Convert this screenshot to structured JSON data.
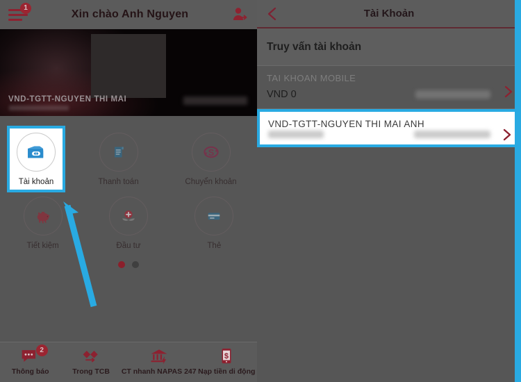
{
  "colors": {
    "accent_blue": "#29aae2",
    "brand_red": "#8e2230",
    "overlay_gray": "#565656",
    "white": "#ffffff"
  },
  "left_panel": {
    "header": {
      "menu_icon": "hamburger-menu-icon",
      "menu_badge": "1",
      "title": "Xin chào Anh Nguyen",
      "logout_icon": "logout-person-icon"
    },
    "hero": {
      "account_label": "VND-TGTT-NGUYEN THI MAI"
    },
    "grid": {
      "rows": [
        [
          {
            "label": "Tài khoản",
            "icon": "wallet-icon",
            "selected": true
          },
          {
            "label": "Thanh toán",
            "icon": "bill-icon",
            "selected": false
          },
          {
            "label": "Chuyển khoản",
            "icon": "transfer-money-icon",
            "selected": false
          }
        ],
        [
          {
            "label": "Tiết kiệm",
            "icon": "piggy-bank-icon",
            "selected": false
          },
          {
            "label": "Đầu tư",
            "icon": "investment-icon",
            "selected": false
          },
          {
            "label": "Thẻ",
            "icon": "credit-card-icon",
            "selected": false
          }
        ]
      ],
      "page_dots": [
        {
          "state": "active"
        },
        {
          "state": "idle"
        }
      ]
    },
    "bottom_nav": [
      {
        "label": "Thông báo",
        "icon": "chat-bubble-icon",
        "badge": "2"
      },
      {
        "label": "Trong TCB",
        "icon": "transfer-arrow-icon",
        "badge": ""
      },
      {
        "label": "CT nhanh NAPAS 247",
        "icon": "bank-bolt-icon",
        "badge": ""
      },
      {
        "label": "Nạp tiền di động",
        "icon": "mobile-topup-icon",
        "badge": ""
      }
    ],
    "annotation": {
      "arrow_icon": "blue-pointer-arrow",
      "arrow_color": "#29aae2"
    }
  },
  "right_panel": {
    "header": {
      "back_icon": "back-chevron-icon",
      "title": "Tài Khoản"
    },
    "section_title": "Truy vấn tài khoản",
    "accounts": [
      {
        "title": "TAI KHOAN MOBILE",
        "value": "VND 0",
        "masked_right": true,
        "masked_left": false,
        "chevron_icon": "chevron-right-icon",
        "highlighted": false
      },
      {
        "title": "VND-TGTT-NGUYEN THI MAI ANH",
        "value": "",
        "masked_right": true,
        "masked_left": true,
        "chevron_icon": "chevron-right-icon",
        "highlighted": true
      }
    ]
  }
}
